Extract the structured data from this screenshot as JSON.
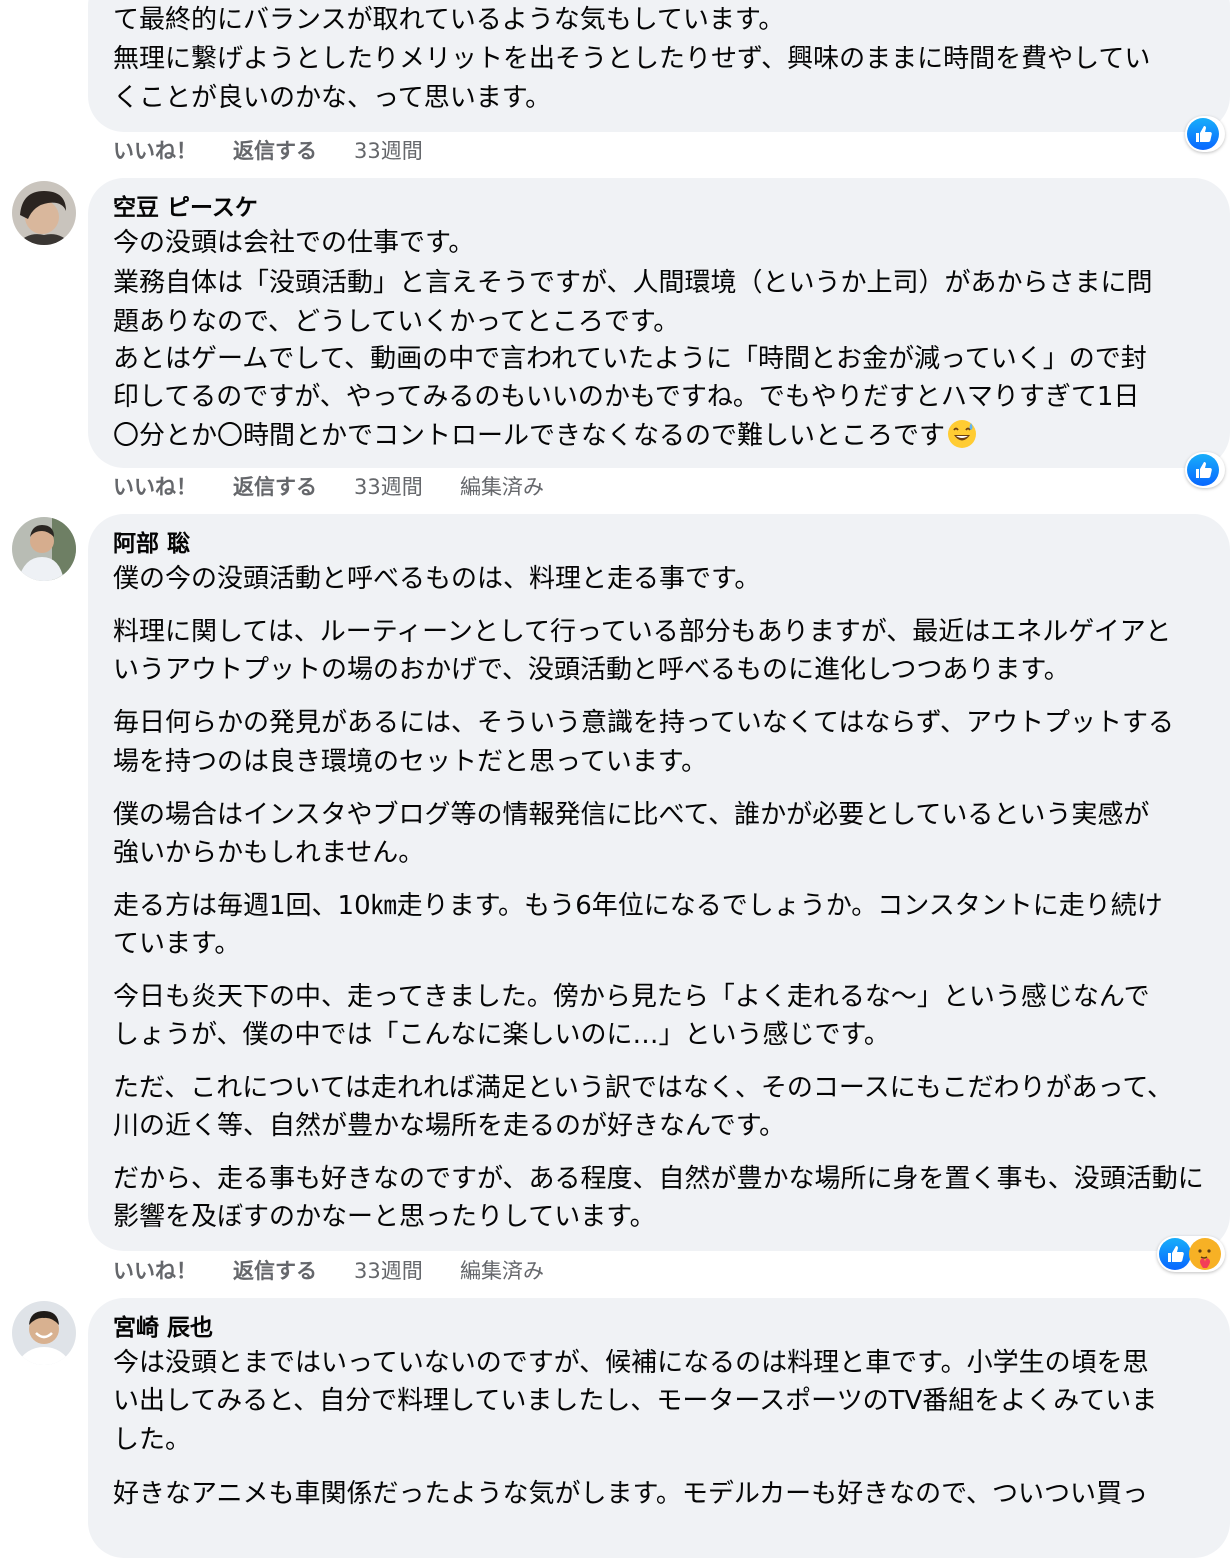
{
  "comments": [
    {
      "author": "",
      "lines": [
        "て最終的にバランスが取れているような気もしています。",
        "無理に繋げようとしたりメリットを出そうとしたりせず、興味のままに時間を費やしてい",
        "くことが良いのかな、って思います。"
      ],
      "actions": {
        "like": "いいね！",
        "reply": "返信する",
        "time": "33週間",
        "edited": ""
      },
      "reactions": [
        "like-icon"
      ]
    },
    {
      "author": "空豆 ピースケ",
      "lines": [
        "今の没頭は会社での仕事です。",
        "業務自体は「没頭活動」と言えそうですが、人間環境（というか上司）があからさまに問",
        "題ありなので、どうしていくかってところです。",
        "あとはゲームでして、動画の中で言われていたように「時間とお金が減っていく」ので封",
        "印してるのですが、やってみるのもいいのかもですね。でもやりだすとハマりすぎて1日",
        "〇分とか〇時間とかでコントロールできなくなるので難しいところです"
      ],
      "trailing_emoji": "grinning-sweat-emoji",
      "actions": {
        "like": "いいね！",
        "reply": "返信する",
        "time": "33週間",
        "edited": "編集済み"
      },
      "reactions": [
        "like-icon"
      ]
    },
    {
      "author": "阿部 聡",
      "lines": [
        "僕の今の没頭活動と呼べるものは、料理と走る事です。",
        "料理に関しては、ルーティーンとして行っている部分もありますが、最近はエネルゲイアと",
        "いうアウトプットの場のおかげで、没頭活動と呼べるものに進化しつつあります。",
        "毎日何らかの発見があるには、そういう意識を持っていなくてはならず、アウトプットする",
        "場を持つのは良き環境のセットだと思っています。",
        "僕の場合はインスタやブログ等の情報発信に比べて、誰かが必要としているという実感が",
        "強いからかもしれません。",
        "走る方は毎週1回、10㎞走ります。もう6年位になるでしょうか。コンスタントに走り続け",
        "ています。",
        "今日も炎天下の中、走ってきました。傍から見たら「よく走れるな〜」という感じなんで",
        "しょうが、僕の中では「こんなに楽しいのに…」という感じです。",
        "ただ、これについては走れれば満足という訳ではなく、そのコースにもこだわりがあって、",
        "川の近く等、自然が豊かな場所を走るのが好きなんです。",
        "だから、走る事も好きなのですが、ある程度、自然が豊かな場所に身を置く事も、没頭活動に",
        "影響を及ぼすのかなーと思ったりしています。"
      ],
      "actions": {
        "like": "いいね！",
        "reply": "返信する",
        "time": "33週間",
        "edited": "編集済み"
      },
      "reactions": [
        "like-icon",
        "care-icon"
      ]
    },
    {
      "author": "宮崎 辰也",
      "lines": [
        "今は没頭とまではいっていないのですが、候補になるのは料理と車です。小学生の頃を思",
        "い出してみると、自分で料理していましたし、モータースポーツのTV番組をよくみていま",
        "した。",
        "好きなアニメも車関係だったような気がします。モデルカーも好きなので、ついつい買っ"
      ]
    }
  ],
  "colors": {
    "bubble_bg": "#f0f2f5",
    "text": "#050505",
    "meta": "#65676b",
    "like_blue": "#0866ff"
  }
}
